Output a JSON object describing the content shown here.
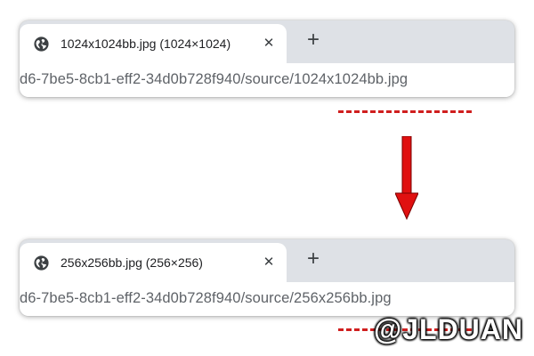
{
  "top_window": {
    "tab_title": "1024x1024bb.jpg (1024×1024)",
    "close_glyph": "✕",
    "new_tab_glyph": "+",
    "url": "d6-7be5-8cb1-eff2-34d0b728f940/source/1024x1024bb.jpg"
  },
  "bottom_window": {
    "tab_title": "256x256bb.jpg (256×256)",
    "close_glyph": "✕",
    "new_tab_glyph": "+",
    "url": "d6-7be5-8cb1-eff2-34d0b728f940/source/256x256bb.jpg"
  },
  "watermark": "@JLDUAN",
  "colors": {
    "tabstrip": "#dee1e6",
    "annotation_red": "#d01f1f",
    "arrow_red": "#e01010"
  },
  "icons": [
    "globe-icon",
    "close-icon",
    "plus-icon",
    "arrow-down-icon"
  ]
}
